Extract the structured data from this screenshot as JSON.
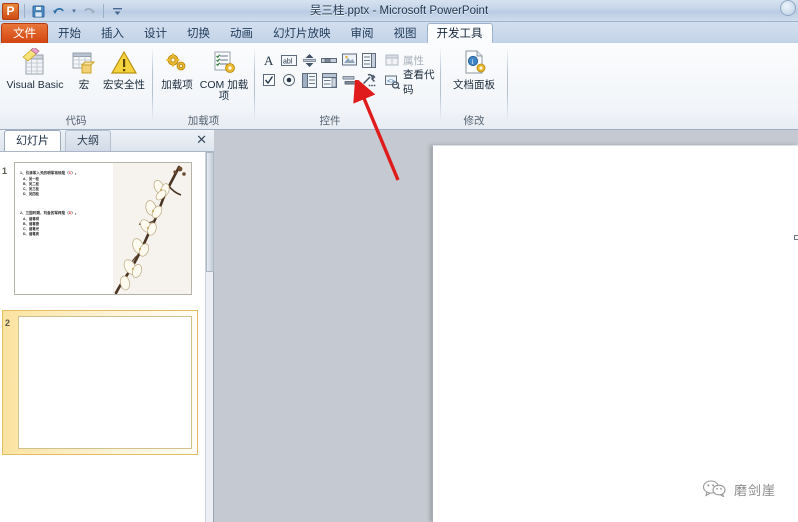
{
  "window": {
    "title": "吴三桂.pptx  -  Microsoft PowerPoint",
    "logo_letter": "P"
  },
  "quick_access": {
    "save_icon": "save-icon",
    "undo_icon": "undo-icon",
    "redo_icon": "redo-icon",
    "customize_icon": "chevron-down-icon"
  },
  "tabs": [
    {
      "label": "文件",
      "kind": "file"
    },
    {
      "label": "开始",
      "kind": "normal"
    },
    {
      "label": "插入",
      "kind": "normal"
    },
    {
      "label": "设计",
      "kind": "normal"
    },
    {
      "label": "切换",
      "kind": "normal"
    },
    {
      "label": "动画",
      "kind": "normal"
    },
    {
      "label": "幻灯片放映",
      "kind": "normal"
    },
    {
      "label": "审阅",
      "kind": "normal"
    },
    {
      "label": "视图",
      "kind": "normal"
    },
    {
      "label": "开发工具",
      "kind": "active"
    }
  ],
  "ribbon": {
    "groups": [
      {
        "name": "code",
        "label": "代码"
      },
      {
        "name": "addins",
        "label": "加载项"
      },
      {
        "name": "controls",
        "label": "控件"
      },
      {
        "name": "modify",
        "label": "修改"
      }
    ],
    "code": {
      "visual_basic": "Visual Basic",
      "macro": "宏",
      "macro_security": "宏安全性"
    },
    "addins": {
      "add_in": "加载项",
      "com_add_in": "COM 加载项"
    },
    "controls": {
      "row1": [
        "label-control",
        "textbox-control",
        "spinbutton-control",
        "scrollbar-control",
        "image-control",
        "combobox-control"
      ],
      "row2": [
        "checkbox-control",
        "optionbutton-control",
        "listbox-control",
        "dropdown-control",
        "togglebutton-control",
        "more-controls"
      ],
      "properties": "属性",
      "view_code": "查看代码"
    },
    "modify": {
      "document_panel": "文档面板"
    }
  },
  "left_panel": {
    "tabs": [
      {
        "label": "幻灯片",
        "active": true
      },
      {
        "label": "大纲",
        "active": false
      }
    ],
    "close_glyph": "✕",
    "slides": [
      {
        "number": "1",
        "selected": false,
        "questions": [
          {
            "stem_prefix": "1、引清军入关的明军将领是（",
            "answer": "C",
            "stem_suffix": "）。",
            "options": [
              "A、吴一桂",
              "B、吴二桂",
              "C、吴三桂",
              "D、吴四桂"
            ]
          },
          {
            "stem_prefix": "2、三国时期，刘备的军师是（",
            "answer": "D",
            "stem_suffix": "）。",
            "options": [
              "A、诸葛明",
              "B、诸葛德",
              "C、诸葛光",
              "D、诸葛亮"
            ]
          }
        ],
        "picture": "magnolia-branch-image"
      },
      {
        "number": "2",
        "selected": true,
        "questions": [],
        "picture": ""
      }
    ]
  },
  "workspace": {
    "slide_content": "",
    "watermark": {
      "icon": "wechat-icon",
      "text": "磨剑崖"
    }
  },
  "annotation": {
    "arrow": "red-arrow-pointer",
    "color": "#e01b1b"
  },
  "colors": {
    "accent": "#d1430f",
    "answer_red": "#e02020",
    "selection": "#fbe3a0"
  }
}
